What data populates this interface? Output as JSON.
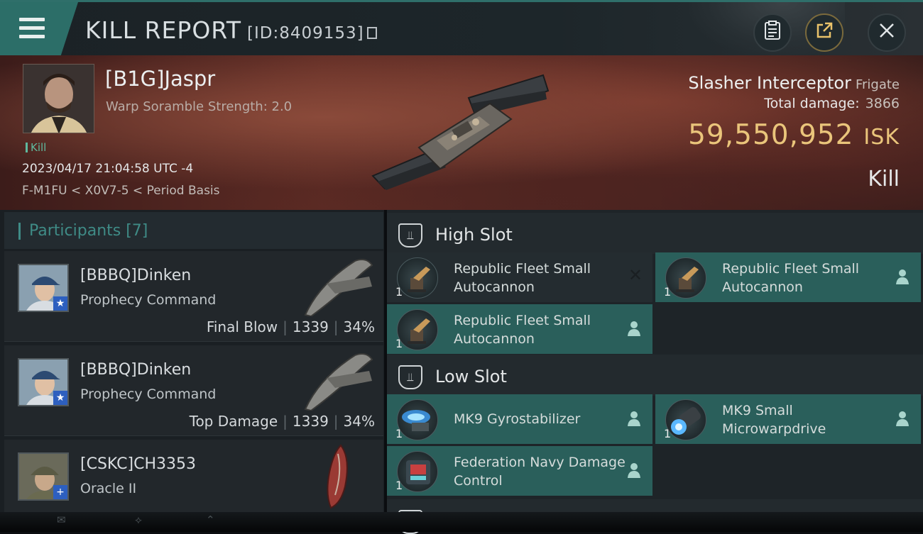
{
  "header": {
    "title": "KILL REPORT",
    "report_id": "[ID:8409153]"
  },
  "victim": {
    "name": "[B1G]Jaspr",
    "subtitle": "Warp Soramble Strength: 2.0",
    "tag": "Kill",
    "datetime": "2023/04/17 21:04:58 UTC -4",
    "location": "F-M1FU < X0V7-5 < Period Basis",
    "ship": "Slasher Interceptor",
    "ship_class": "Frigate",
    "total_damage_label": "Total damage:",
    "total_damage": "3866",
    "isk_value": "59,550,952",
    "isk_unit": "ISK",
    "result": "Kill"
  },
  "participants": {
    "header": "Participants [7]",
    "items": [
      {
        "name": "[BBBQ]Dinken",
        "ship": "Prophecy Command",
        "role": "Final Blow",
        "damage": "1339",
        "percent": "34%",
        "badge": "★"
      },
      {
        "name": "[BBBQ]Dinken",
        "ship": "Prophecy Command",
        "role": "Top Damage",
        "damage": "1339",
        "percent": "34%",
        "badge": "★"
      },
      {
        "name": "[CSKC]CH3353",
        "ship": "Oracle II",
        "badge": "+"
      }
    ]
  },
  "fittings": {
    "high_slot_title": "High Slot",
    "low_slot_title": "Low Slot",
    "high": [
      {
        "name": "Republic Fleet Small Autocannon",
        "qty": "1"
      },
      {
        "name": "Republic Fleet Small Autocannon",
        "qty": "1"
      },
      {
        "name": "Republic Fleet Small Autocannon",
        "qty": "1"
      }
    ],
    "low": [
      {
        "name": "MK9 Gyrostabilizer",
        "qty": "1"
      },
      {
        "name": "MK9 Small Microwarpdrive",
        "qty": "1"
      },
      {
        "name": "Federation Navy Damage Control",
        "qty": "1"
      }
    ]
  },
  "colors": {
    "accent_teal": "#2c6e68",
    "isk_gold": "#eac57b",
    "module_bg": "#2a5f5b"
  }
}
